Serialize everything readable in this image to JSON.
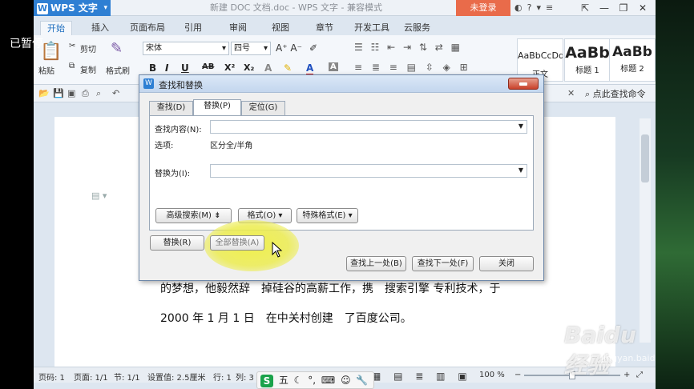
{
  "overlay": {
    "paused": "已暂停"
  },
  "titlebar": {
    "app_name": "WPS 文字",
    "doc_title": "新建 DOC 文档.doc - WPS 文字 - 兼容模式",
    "login": "未登录"
  },
  "tabs": [
    "开始",
    "插入",
    "页面布局",
    "引用",
    "审阅",
    "视图",
    "章节",
    "开发工具",
    "云服务"
  ],
  "ribbon": {
    "paste": "粘贴",
    "cut": "剪切",
    "copy": "复制",
    "format_painter": "格式刷",
    "font_name": "宋体",
    "font_size": "四号",
    "styles": [
      {
        "preview": "AaBbCcDd",
        "name": "正文"
      },
      {
        "preview": "AaBb",
        "name": "标题 1"
      },
      {
        "preview": "AaBb",
        "name": "标题 2"
      }
    ]
  },
  "qat": {
    "find_command": "点此查找命令"
  },
  "document": {
    "line1": "的梦想，他毅然辞　掉硅谷的高薪工作，携　搜索引擎 专利技术，于",
    "line2": "2000 年 1 月 1 日　在中关村创建　了百度公司。"
  },
  "statusbar": {
    "page_num": "页码: 1",
    "pages": "页面: 1/1",
    "section": "节: 1/1",
    "setting": "设置值: 2.5厘米",
    "row": "行: 1",
    "col": "列: 3",
    "zoom": "100 %",
    "zoom_level": 0.5
  },
  "dialog": {
    "title": "查找和替换",
    "tabs": [
      "查找(D)",
      "替换(P)",
      "定位(G)"
    ],
    "active_tab": "替换(P)",
    "find_label": "查找内容(N):",
    "find_value": "",
    "options_label": "选项:",
    "options_value": "区分全/半角",
    "replace_label": "替换为(I):",
    "replace_value": "",
    "advanced": "高级搜索(M) ⇟",
    "format": "格式(O) ▾",
    "special": "特殊格式(E) ▾",
    "replace_btn": "替换(R)",
    "replace_all_btn": "全部替换(A)",
    "find_prev": "查找上一处(B)",
    "find_next": "查找下一处(F)",
    "close": "关闭"
  },
  "watermark": {
    "text": "Baidu经验",
    "url": "jingyan.baidu.com"
  },
  "taskbar": {
    "ime": "五"
  }
}
